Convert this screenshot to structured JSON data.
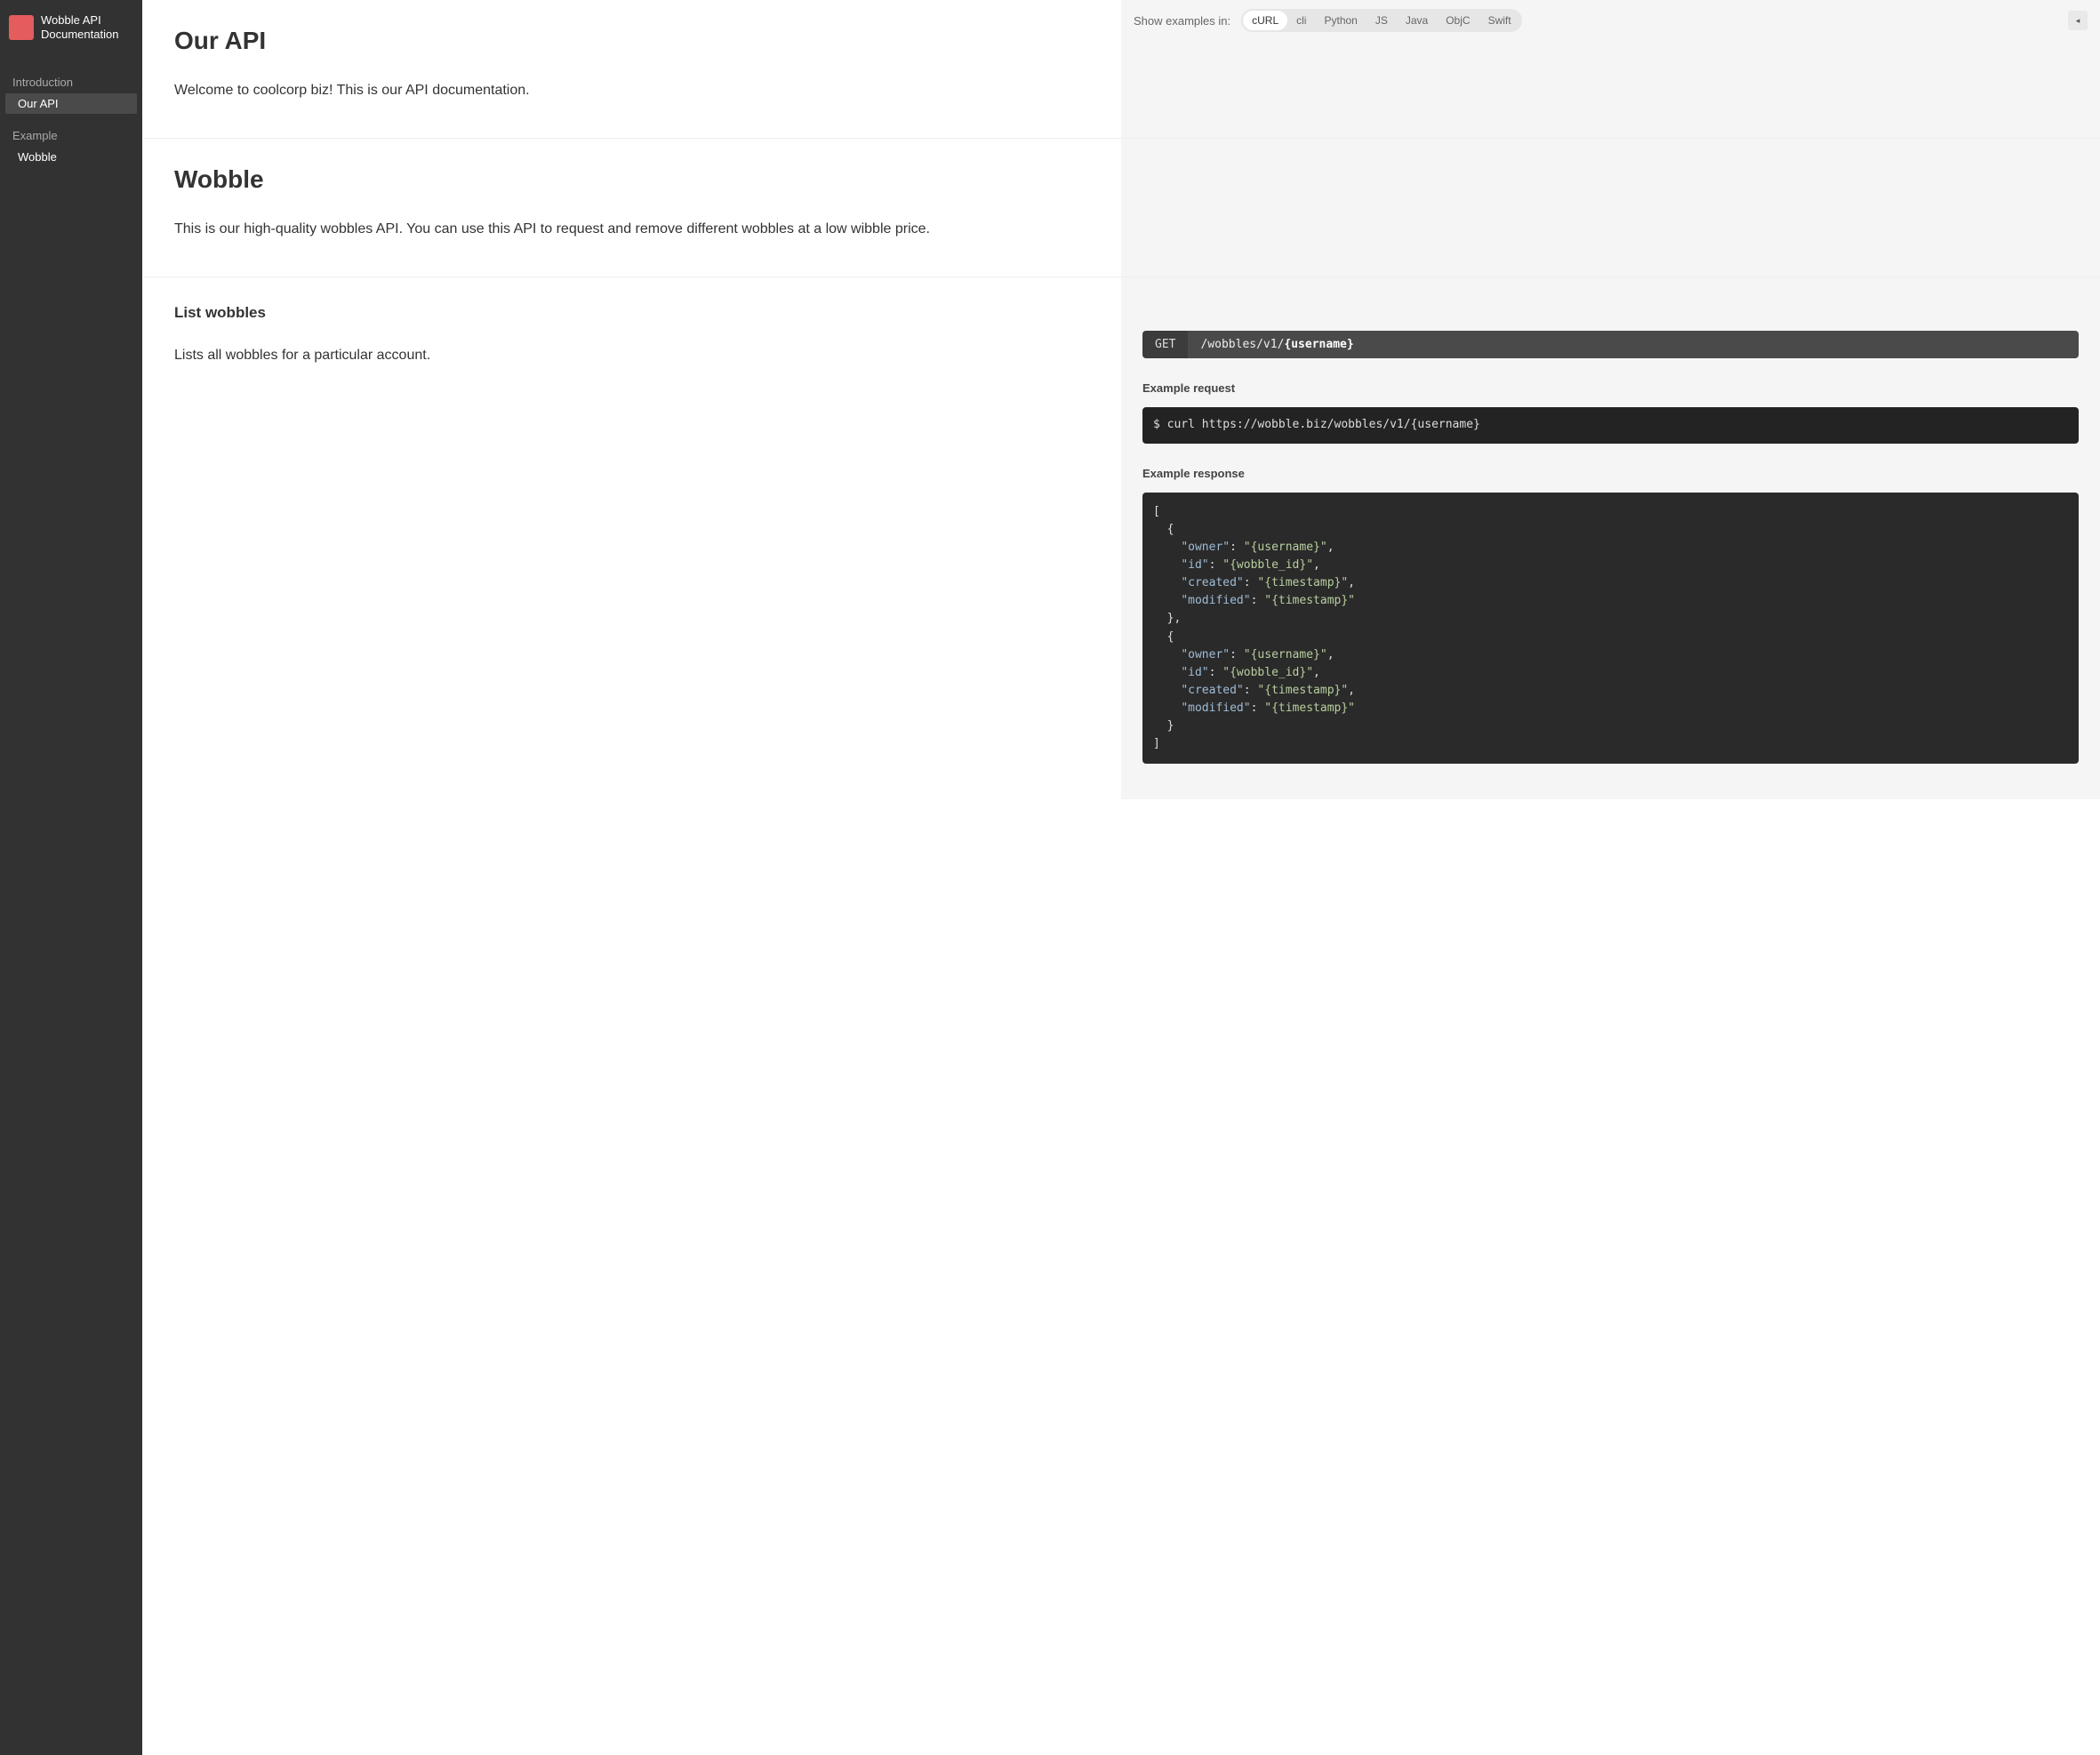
{
  "brand": {
    "title": "Wobble API Documentation"
  },
  "nav": {
    "groups": [
      {
        "title": "Introduction",
        "items": [
          {
            "label": "Our API",
            "active": true
          }
        ]
      },
      {
        "title": "Example",
        "items": [
          {
            "label": "Wobble",
            "active": false
          }
        ]
      }
    ]
  },
  "topbar": {
    "label": "Show examples in:",
    "languages": [
      "cURL",
      "cli",
      "Python",
      "JS",
      "Java",
      "ObjC",
      "Swift"
    ],
    "active_language": "cURL"
  },
  "sections": {
    "our_api": {
      "title": "Our API",
      "text": "Welcome to coolcorp biz! This is our API documentation."
    },
    "wobble": {
      "title": "Wobble",
      "text": "This is our high-quality wobbles API. You can use this API to request and remove different wobbles at a low wibble price."
    },
    "list_wobbles": {
      "title": "List wobbles",
      "text": "Lists all wobbles for a particular account.",
      "endpoint": {
        "method": "GET",
        "path_prefix": "/wobbles/v1/",
        "path_param": "{username}"
      },
      "example_request_label": "Example request",
      "example_request": "$ curl https://wobble.biz/wobbles/v1/{username}",
      "example_response_label": "Example response",
      "example_response": [
        {
          "owner": "{username}",
          "id": "{wobble_id}",
          "created": "{timestamp}",
          "modified": "{timestamp}"
        },
        {
          "owner": "{username}",
          "id": "{wobble_id}",
          "created": "{timestamp}",
          "modified": "{timestamp}"
        }
      ]
    }
  }
}
